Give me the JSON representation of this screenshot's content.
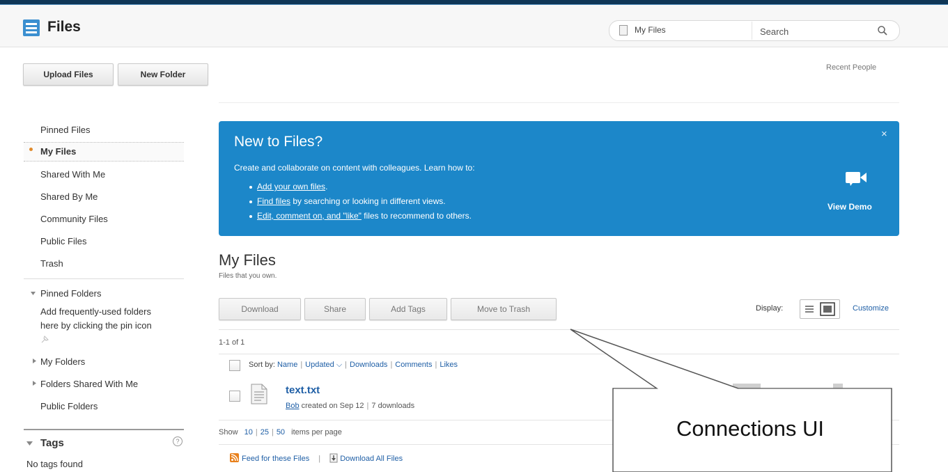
{
  "app": {
    "title": "Files",
    "search_scope": "My Files",
    "search_placeholder": "Search"
  },
  "toolbar": {
    "upload_label": "Upload Files",
    "new_folder_label": "New Folder",
    "recent_people": "Recent People"
  },
  "sidebar": {
    "items": [
      {
        "label": "Pinned Files"
      },
      {
        "label": "My Files",
        "selected": true
      },
      {
        "label": "Shared With Me"
      },
      {
        "label": "Shared By Me"
      },
      {
        "label": "Community Files"
      },
      {
        "label": "Public Files"
      },
      {
        "label": "Trash"
      }
    ],
    "pinned_folders": {
      "label": "Pinned Folders",
      "hint_line1": "Add frequently-used folders",
      "hint_line2": "here by clicking the pin icon"
    },
    "my_folders": "My Folders",
    "folders_shared": "Folders Shared With Me",
    "public_folders": "Public Folders",
    "tags_title": "Tags",
    "no_tags": "No tags found"
  },
  "banner": {
    "title": "New to Files?",
    "intro": "Create and collaborate on content with colleagues. Learn how to:",
    "bullet1_link": "Add your own files",
    "bullet1_rest": ".",
    "bullet2_link": "Find files",
    "bullet2_rest": " by searching or looking in different views.",
    "bullet3_link": "Edit, comment on, and \"like\"",
    "bullet3_rest": " files to recommend to others.",
    "close": "×",
    "view_demo": "View Demo"
  },
  "main": {
    "title": "My Files",
    "subtitle": "Files that you own.",
    "actions": {
      "download": "Download",
      "share": "Share",
      "add_tags": "Add Tags",
      "move_to_trash": "Move to Trash"
    },
    "display_label": "Display:",
    "customize": "Customize",
    "paging_count": "1-1 of 1",
    "sort": {
      "label": "Sort by:",
      "name": "Name",
      "updated": "Updated ⌵",
      "downloads": "Downloads",
      "comments": "Comments",
      "likes": "Likes"
    },
    "files": [
      {
        "name": "text.txt",
        "author": "Bob",
        "meta": " created on Sep 12",
        "downloads": "7 downloads"
      }
    ],
    "show_label": "Show",
    "page_sizes": [
      "10",
      "25",
      "50"
    ],
    "items_per_page": "items per page",
    "feed_label": "Feed for these Files",
    "download_all": "Download All Files"
  },
  "callout": {
    "text": "Connections UI"
  },
  "colors": {
    "banner": "#1c87c9",
    "link": "#1f5fa6",
    "topbar": "#0f3656"
  }
}
